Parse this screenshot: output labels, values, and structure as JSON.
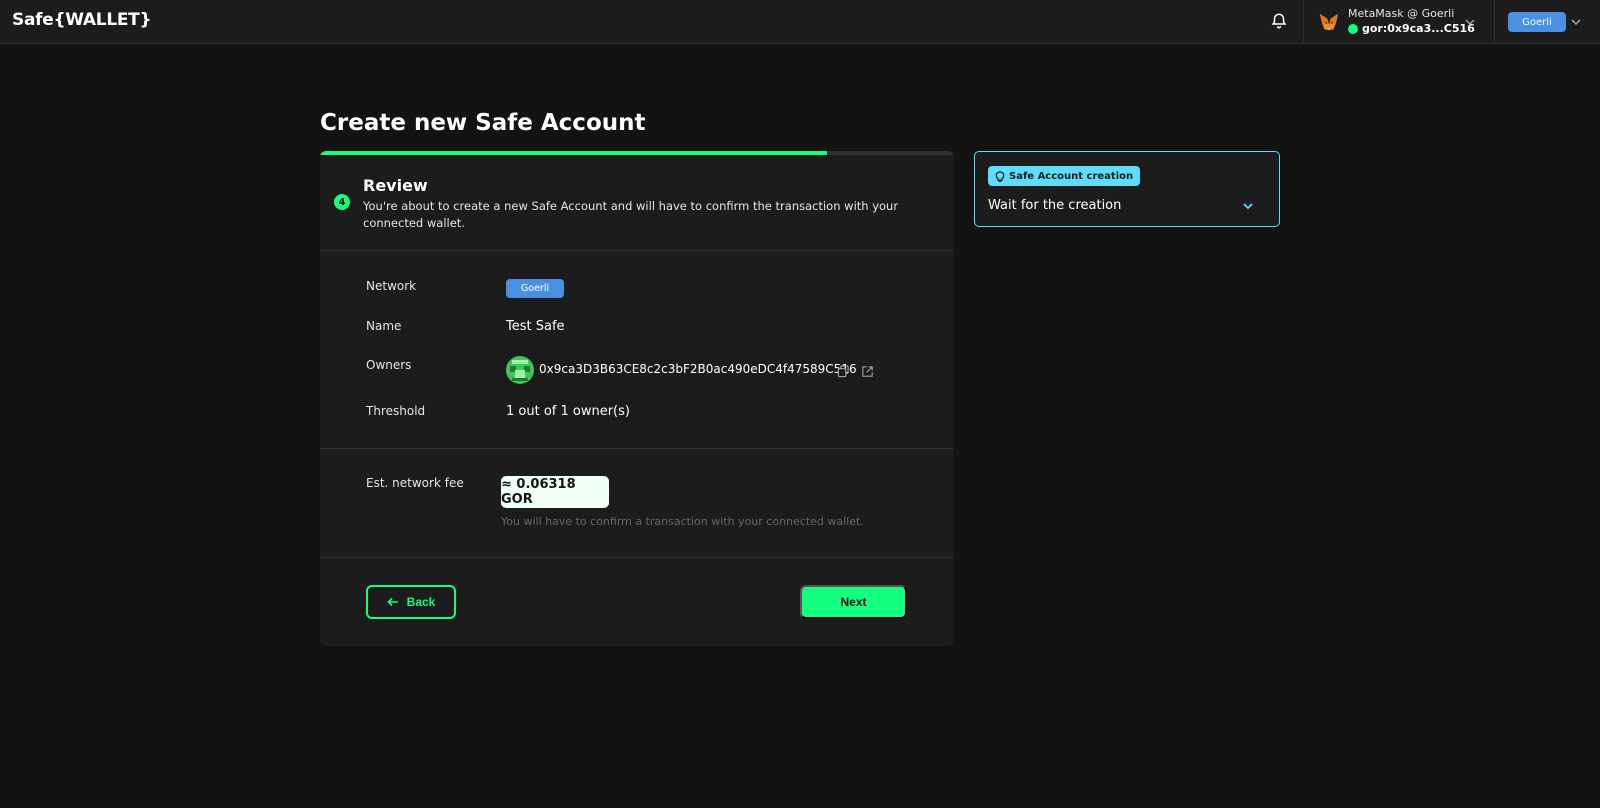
{
  "header": {
    "logo": "Safe{WALLET}",
    "wallet_name": "MetaMask @ Goerli",
    "wallet_address": "gor:0x9ca3...C516",
    "network_chip": "Goerli"
  },
  "main": {
    "title": "Create new Safe Account",
    "progress_fraction": 0.8,
    "step": {
      "number": "4",
      "title": "Review",
      "description": "You're about to create a new Safe Account and will have to confirm the transaction with your connected wallet."
    },
    "details": {
      "network_label": "Network",
      "network_value": "Goerli",
      "name_label": "Name",
      "name_value": "Test Safe",
      "owners_label": "Owners",
      "owner_address": "0x9ca3D3B63CE8c2c3bF2B0ac490eDC4f47589C516",
      "threshold_label": "Threshold",
      "threshold_value": "1 out of 1 owner(s)"
    },
    "fee": {
      "label": "Est. network fee",
      "value": "≈ 0.06318 GOR",
      "note": "You will have to confirm a transaction with your connected wallet."
    },
    "buttons": {
      "back": "Back",
      "next": "Next"
    }
  },
  "side_panel": {
    "chip": "Safe Account creation",
    "title": "Wait for the creation"
  },
  "colors": {
    "background": "#121312",
    "card": "#1c1c1c",
    "accent": "#12ff80",
    "info": "#5fddff",
    "network": "#4a90e2"
  }
}
